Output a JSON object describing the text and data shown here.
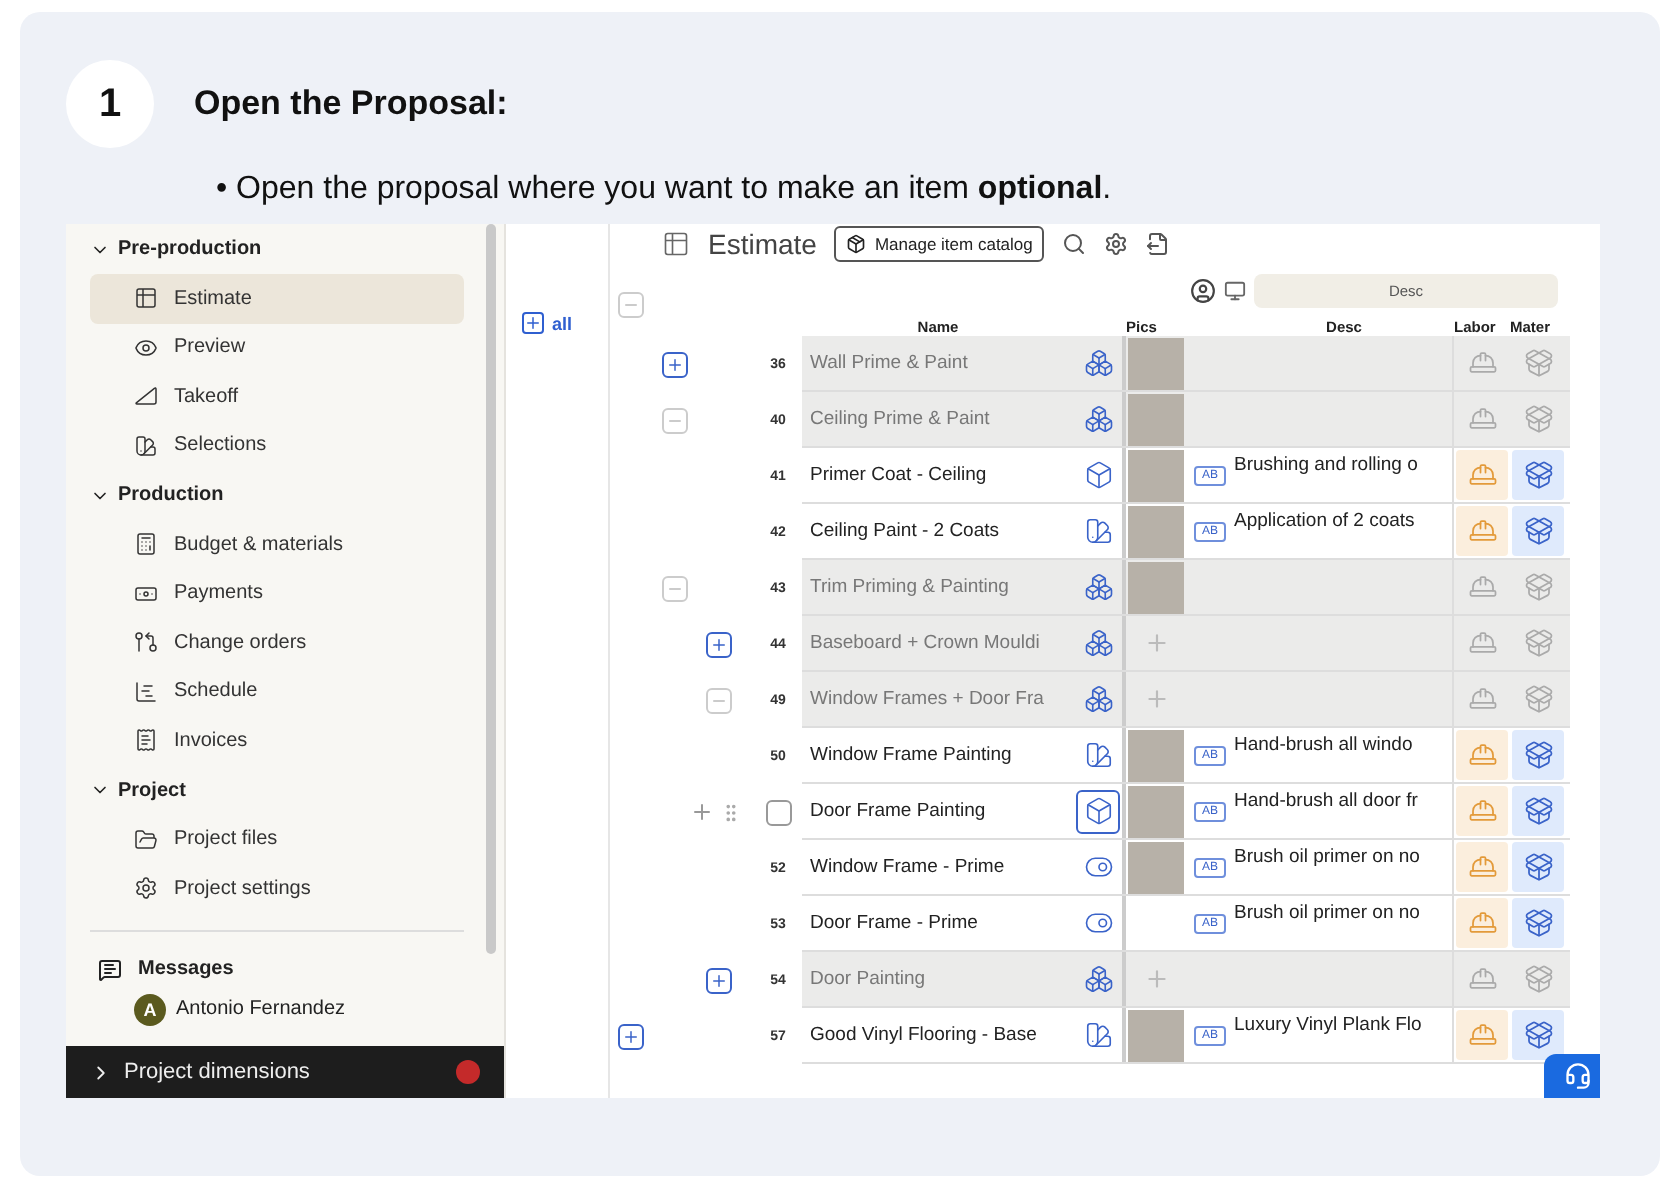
{
  "step": {
    "number": "1",
    "title": "Open the Proposal:"
  },
  "instruction": "• Open the proposal where you want to make an item **optional**.",
  "sidebar": {
    "sections": [
      {
        "label": "Pre-production",
        "expanded": true,
        "items": [
          {
            "label": "Estimate",
            "selected": true
          },
          {
            "label": "Preview",
            "selected": false
          },
          {
            "label": "Takeoff",
            "selected": false
          },
          {
            "label": "Selections",
            "selected": false
          }
        ]
      },
      {
        "label": "Production",
        "expanded": true,
        "items": [
          {
            "label": "Budget & materials",
            "selected": false
          },
          {
            "label": "Payments",
            "selected": false
          },
          {
            "label": "Change orders",
            "selected": false
          },
          {
            "label": "Schedule",
            "selected": false
          },
          {
            "label": "Invoices",
            "selected": false
          }
        ]
      },
      {
        "label": "Project",
        "expanded": true,
        "items": [
          {
            "label": "Project files",
            "selected": false
          },
          {
            "label": "Project settings",
            "selected": false
          }
        ]
      }
    ],
    "messages": {
      "label": "Messages",
      "initial": "A",
      "name": "Antonio Fernandez"
    },
    "footer": {
      "label": "Project dimensions"
    }
  },
  "toolbar": {
    "title": "Estimate",
    "catalog_button": "Manage item catalog",
    "view_pill": "Desc"
  },
  "tree_filter": "all",
  "columns": [
    "Name",
    "Pics",
    "Desc",
    "Labor",
    "Mater"
  ],
  "tree": [
    {
      "expanded": true,
      "children": [
        {
          "number": "36",
          "name": "Wall Prime & Paint",
          "kind": "assembly",
          "expanded": false,
          "photo": true,
          "assigned": false
        },
        {
          "number": "40",
          "name": "Ceiling Prime & Paint",
          "kind": "assembly",
          "expanded": true,
          "photo": true,
          "assigned": false,
          "children": [
            {
              "number": "41",
              "name": "Primer Coat - Ceiling",
              "kind": "material",
              "photo": true,
              "badge": "AB",
              "desc": "Brushing and rolling o",
              "assigned": true
            },
            {
              "number": "42",
              "name": "Ceiling Paint - 2 Coats",
              "kind": "selection",
              "photo": true,
              "badge": "AB",
              "desc": "Application of 2 coats",
              "assigned": true
            }
          ]
        },
        {
          "number": "43",
          "name": "Trim Priming & Painting",
          "kind": "assembly",
          "expanded": true,
          "photo": true,
          "assigned": false,
          "children": [
            {
              "number": "44",
              "name": "Baseboard + Crown Mouldi",
              "kind": "assembly",
              "expanded": false,
              "photo": false,
              "assigned": false
            },
            {
              "number": "49",
              "name": "Window Frames + Door Fra",
              "kind": "assembly",
              "expanded": true,
              "photo": false,
              "assigned": false,
              "children": [
                {
                  "number": "50",
                  "name": "Window Frame Painting",
                  "kind": "selection",
                  "photo": true,
                  "badge": "AB",
                  "desc": "Hand-brush all windo",
                  "assigned": true
                },
                {
                  "name": "Door Frame Painting",
                  "kind": "material",
                  "photo": true,
                  "badge": "AB",
                  "desc": "Hand-brush all door fr",
                  "assigned": true,
                  "hovered": true,
                  "checked": false
                },
                {
                  "number": "52",
                  "name": "Window Frame - Prime",
                  "kind": "option",
                  "photo": true,
                  "badge": "AB",
                  "desc": "Brush oil primer on no",
                  "assigned": true
                },
                {
                  "number": "53",
                  "name": "Door Frame - Prime",
                  "kind": "option",
                  "photo": false,
                  "badge": "AB",
                  "desc": "Brush oil primer on no",
                  "assigned": true
                }
              ]
            },
            {
              "number": "54",
              "name": "Door Painting",
              "kind": "assembly",
              "expanded": false,
              "photo": false,
              "assigned": false
            }
          ]
        }
      ]
    },
    {
      "number": "57",
      "name": "Good Vinyl Flooring - Base",
      "kind": "selection",
      "expanded": false,
      "photo": true,
      "badge": "AB",
      "desc": "Luxury Vinyl Plank Flo",
      "assigned": true
    }
  ]
}
